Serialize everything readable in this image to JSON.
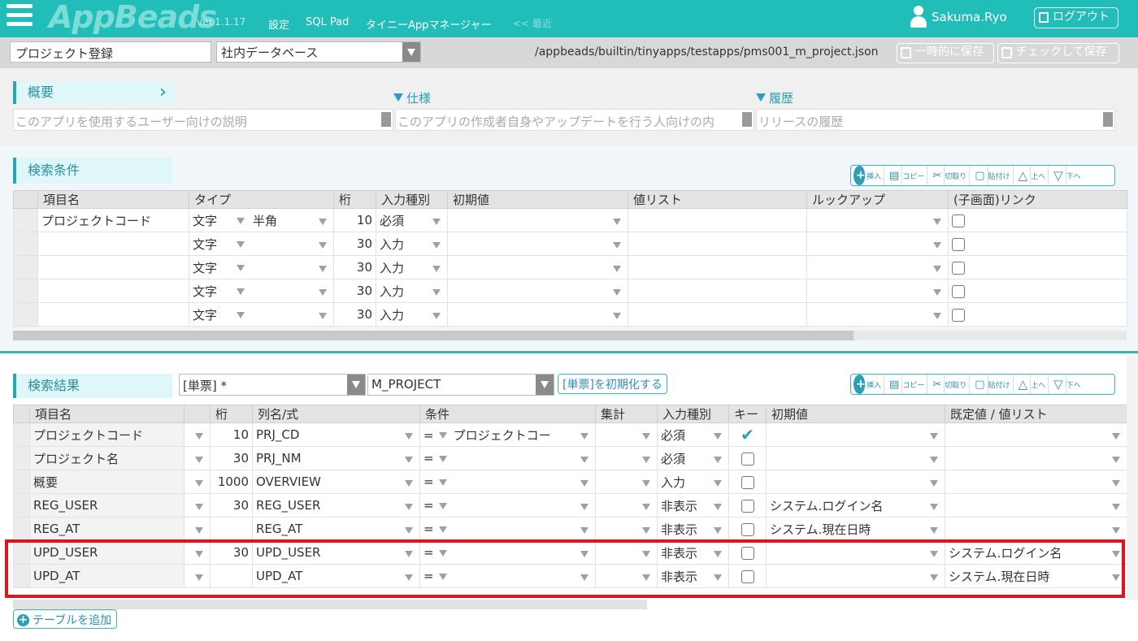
{
  "header": {
    "logo": "AppBeads",
    "version": "ver.1.1.17",
    "nav": [
      "設定",
      "SQL Pad",
      "タイニーAppマネージャー",
      "<< 最近"
    ],
    "user": "Sakuma.Ryo",
    "logout": "ログアウト"
  },
  "toolbar": {
    "app_name": "プロジェクト登録",
    "database": "社内データベース",
    "path": "/appbeads/builtin/tinyapps/testapps/pms001_m_project.json",
    "save_temp": "一時的に保存",
    "save_check": "チェックして保存"
  },
  "overview": {
    "title": "概要",
    "placeholder": "このアプリを使用するユーザー向けの説明",
    "spec_label": "仕様",
    "spec_placeholder": "このアプリの作成者自身やアップデートを行う人向けの内",
    "history_label": "履歴",
    "history_placeholder": "リリースの履歴"
  },
  "row_buttons": [
    "挿入",
    "コピー",
    "切取り",
    "貼付け",
    "上へ",
    "下へ"
  ],
  "search_conditions": {
    "title": "検索条件",
    "columns": [
      "項目名",
      "タイプ",
      "桁",
      "入力種別",
      "初期値",
      "値リスト",
      "ルックアップ",
      "(子画面)リンク"
    ],
    "rows": [
      {
        "name": "プロジェクトコード",
        "type": "文字",
        "sub": "半角",
        "digits": "10",
        "input": "必須"
      },
      {
        "name": "",
        "type": "文字",
        "sub": "",
        "digits": "30",
        "input": "入力"
      },
      {
        "name": "",
        "type": "文字",
        "sub": "",
        "digits": "30",
        "input": "入力"
      },
      {
        "name": "",
        "type": "文字",
        "sub": "",
        "digits": "30",
        "input": "入力"
      },
      {
        "name": "",
        "type": "文字",
        "sub": "",
        "digits": "30",
        "input": "入力"
      }
    ]
  },
  "search_results": {
    "title": "検索結果",
    "form_select": "[単票] *",
    "table_select": "M_PROJECT",
    "init_button": "[単票]を初期化する",
    "columns": [
      "項目名",
      "",
      "桁",
      "列名/式",
      "条件",
      "集計",
      "入力種別",
      "キー",
      "初期値",
      "既定値 / 値リスト"
    ],
    "rows": [
      {
        "name": "プロジェクトコード",
        "digits": "10",
        "column": "PRJ_CD",
        "op": "=",
        "cond": "プロジェクトコー",
        "input": "必須",
        "key": true,
        "initial": "",
        "default": ""
      },
      {
        "name": "プロジェクト名",
        "digits": "30",
        "column": "PRJ_NM",
        "op": "=",
        "cond": "",
        "input": "必須",
        "key": false,
        "initial": "",
        "default": ""
      },
      {
        "name": "概要",
        "digits": "1000",
        "column": "OVERVIEW",
        "op": "=",
        "cond": "",
        "input": "入力",
        "key": false,
        "initial": "",
        "default": ""
      },
      {
        "name": "REG_USER",
        "digits": "30",
        "column": "REG_USER",
        "op": "=",
        "cond": "",
        "input": "非表示",
        "key": false,
        "initial": "システム.ログイン名",
        "default": ""
      },
      {
        "name": "REG_AT",
        "digits": "",
        "column": "REG_AT",
        "op": "=",
        "cond": "",
        "input": "非表示",
        "key": false,
        "initial": "システム.現在日時",
        "default": ""
      },
      {
        "name": "UPD_USER",
        "digits": "30",
        "column": "UPD_USER",
        "op": "=",
        "cond": "",
        "input": "非表示",
        "key": false,
        "initial": "",
        "default": "システム.ログイン名"
      },
      {
        "name": "UPD_AT",
        "digits": "",
        "column": "UPD_AT",
        "op": "=",
        "cond": "",
        "input": "非表示",
        "key": false,
        "initial": "",
        "default": "システム.現在日時"
      }
    ]
  },
  "add_table": "テーブルを追加"
}
